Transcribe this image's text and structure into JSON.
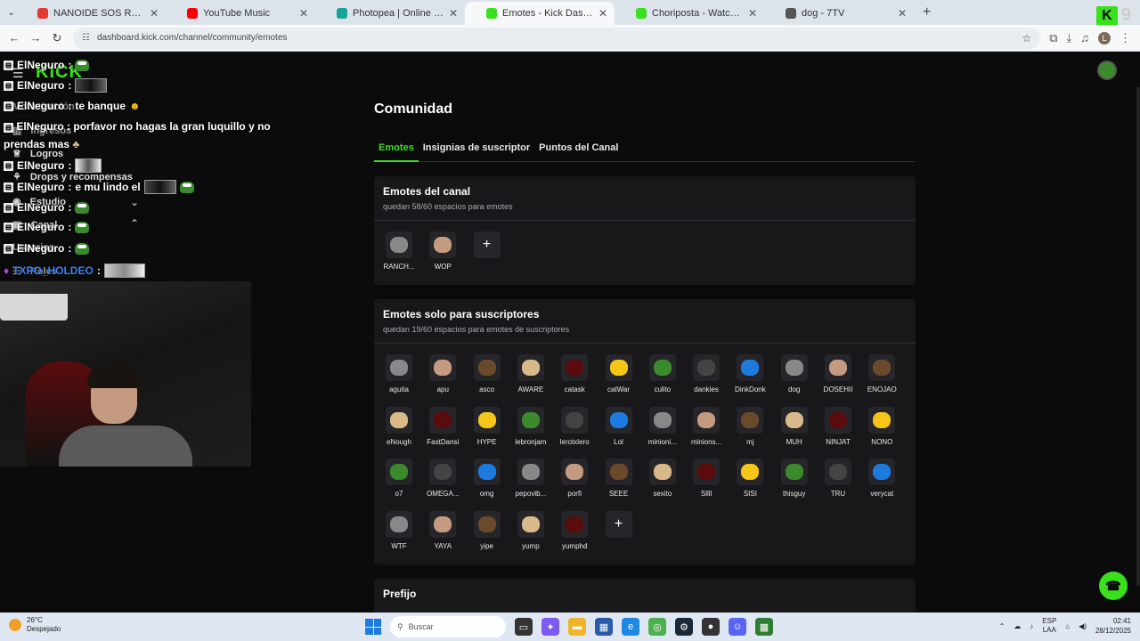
{
  "browser": {
    "tabs": [
      {
        "title": "NANOIDE SOS RE ARGENTINO",
        "favicon_color": "#e53935",
        "active": false
      },
      {
        "title": "YouTube Music",
        "favicon_color": "#ff0000",
        "active": false
      },
      {
        "title": "Photopea | Online Photo Editor",
        "favicon_color": "#18a497",
        "active": false
      },
      {
        "title": "Emotes - Kick Dashboard",
        "favicon_color": "#39e01c",
        "active": true
      },
      {
        "title": "Choriposta - Watch the VOD o",
        "favicon_color": "#39e01c",
        "active": false
      },
      {
        "title": "dog - 7TV",
        "favicon_color": "#555555",
        "active": false
      }
    ],
    "url": "dashboard.kick.com/channel/community/emotes",
    "profile_initial": "L",
    "corner_badge": "K",
    "corner_number": "9"
  },
  "sidebar": {
    "logo": "KICK",
    "items": [
      {
        "label": "Ingresos",
        "icon": "money-icon"
      },
      {
        "label": "Logros",
        "icon": "trophy-icon"
      },
      {
        "label": "Drops y recompensas",
        "icon": "gift-icon"
      },
      {
        "label": "Estudio",
        "icon": "camera-icon"
      },
      {
        "label": "Canal",
        "icon": "channel-icon"
      },
      {
        "label": "Roles",
        "icon": "roles-icon"
      }
    ],
    "partial": [
      "Monetización",
      "Usuarios"
    ]
  },
  "chat": {
    "user": "ElNeguro",
    "sep": ":",
    "lines": [
      {
        "text": ""
      },
      {
        "text": ""
      },
      {
        "text": "te banque"
      },
      {
        "text": "porfavor no hagas la gran luquillo y no prendas mas"
      },
      {
        "text": ""
      },
      {
        "text": "e mu lindo el"
      },
      {
        "text": ""
      },
      {
        "text": ""
      },
      {
        "text": ""
      }
    ],
    "last_user": "TXPO_HOLDEO"
  },
  "page": {
    "title": "Comunidad",
    "tabs": [
      "Emotes",
      "Insignias de suscriptor",
      "Puntos del Canal"
    ],
    "channel_emotes": {
      "title": "Emotes del canal",
      "subtitle": "quedan 58/60 espacios para emotes",
      "emotes": [
        "RANCH...",
        "WOP"
      ]
    },
    "sub_emotes": {
      "title": "Emotes solo para suscriptores",
      "subtitle": "quedan 19/60 espacios para emotes de suscriptores",
      "emotes": [
        "aguita",
        "apu",
        "asco",
        "AWARE",
        "catask",
        "catWar",
        "culito",
        "dankies",
        "DinkDonk",
        "dog",
        "DOSEHII",
        "ENOJAO",
        "eNough",
        "FastDansi",
        "HYPE",
        "lebronjam",
        "lerotxlero",
        "Lol",
        "minioni...",
        "minions...",
        "mj",
        "MUH",
        "NINJAT",
        "NONO",
        "o7",
        "OMEGA...",
        "omg",
        "pepovib...",
        "porfi",
        "SEEE",
        "sexito",
        "Sllll",
        "SISI",
        "thisguy",
        "TRU",
        "verycat",
        "WTF",
        "YAYA",
        "yipe",
        "yump",
        "yumphd"
      ]
    },
    "prefix_title": "Prefijo",
    "add_label": "+"
  },
  "taskbar": {
    "temp": "26°C",
    "weather": "Despejado",
    "search": "Buscar",
    "lang1": "ESP",
    "lang2": "LAA",
    "time": "02:41",
    "date": "28/12/2025"
  }
}
